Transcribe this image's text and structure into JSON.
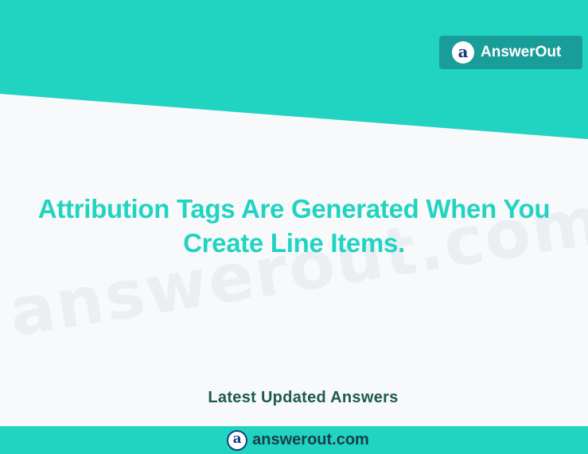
{
  "brand": {
    "logo_letter": "a",
    "name": "AnswerOut"
  },
  "headline": {
    "line1": "Attribution Tags Are Generated When You",
    "line2": "Create Line Items."
  },
  "watermark": {
    "text": "answerout.com"
  },
  "subtitle": "Latest Updated Answers",
  "footer": {
    "logo_letter": "a",
    "url": "answerout.com"
  },
  "colors": {
    "teal": "#21d4c1",
    "badge": "#189d98",
    "background": "#f8f9fa",
    "subtitle": "#1c5c4a",
    "logo_blue": "#1a3d7c"
  }
}
